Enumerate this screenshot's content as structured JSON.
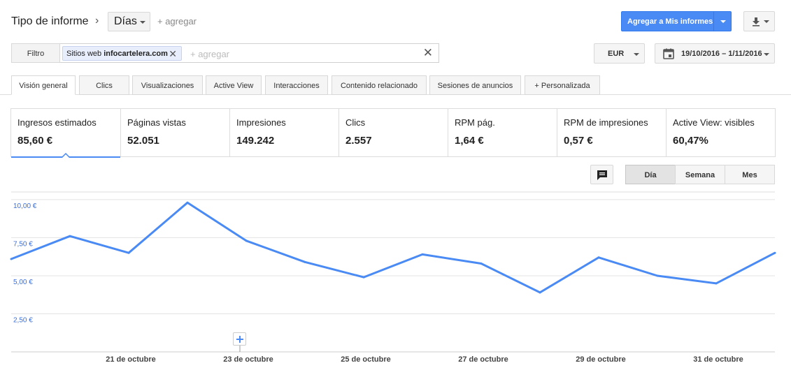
{
  "header": {
    "report_type_label": "Tipo de informe",
    "granularity_value": "Días",
    "add_label": "+ agregar",
    "add_to_reports_label": "Agregar a Mis informes"
  },
  "filter": {
    "filter_button_label": "Filtro",
    "chip_prefix": "Sitios web",
    "chip_value": "infocartelera.com",
    "add_placeholder": "+ agregar",
    "currency": "EUR",
    "date_range": "19/10/2016 – 1/11/2016"
  },
  "tabs": [
    {
      "label": "Visión general",
      "active": true
    },
    {
      "label": "Clics"
    },
    {
      "label": "Visualizaciones"
    },
    {
      "label": "Active View"
    },
    {
      "label": "Interacciones"
    },
    {
      "label": "Contenido relacionado"
    },
    {
      "label": "Sesiones de anuncios"
    },
    {
      "label": "+ Personalizada"
    }
  ],
  "metrics": [
    {
      "label": "Ingresos estimados",
      "value": "85,60 €",
      "active": true
    },
    {
      "label": "Páginas vistas",
      "value": "52.051"
    },
    {
      "label": "Impresiones",
      "value": "149.242"
    },
    {
      "label": "Clics",
      "value": "2.557"
    },
    {
      "label": "RPM pág.",
      "value": "1,64 €"
    },
    {
      "label": "RPM de impresiones",
      "value": "0,57 €"
    },
    {
      "label": "Active View: visibles",
      "value": "60,47%"
    }
  ],
  "period_toggle": {
    "day": "Día",
    "week": "Semana",
    "month": "Mes",
    "selected": "Día"
  },
  "colors": {
    "accent": "#4a8af4",
    "line": "#4a8af4",
    "axis_label": "#3b6fd9"
  },
  "chart_data": {
    "type": "line",
    "ylabels": [
      "10,00 €",
      "7,50 €",
      "5,00 €",
      "2,50 €"
    ],
    "ylim": [
      0,
      10.5
    ],
    "yticks": [
      10,
      7.5,
      5,
      2.5
    ],
    "xlabels": [
      "21 de octubre",
      "23 de octubre",
      "25 de octubre",
      "27 de octubre",
      "29 de octubre",
      "31 de octubre"
    ],
    "x": [
      "19/10/2016",
      "20/10/2016",
      "21/10/2016",
      "22/10/2016",
      "23/10/2016",
      "24/10/2016",
      "25/10/2016",
      "26/10/2016",
      "27/10/2016",
      "28/10/2016",
      "29/10/2016",
      "30/10/2016",
      "31/10/2016",
      "1/11/2016"
    ],
    "series": [
      {
        "values": [
          6.1,
          7.6,
          6.5,
          9.8,
          7.3,
          5.9,
          4.9,
          6.4,
          5.8,
          3.9,
          6.2,
          5.0,
          4.5,
          6.5
        ]
      }
    ]
  }
}
